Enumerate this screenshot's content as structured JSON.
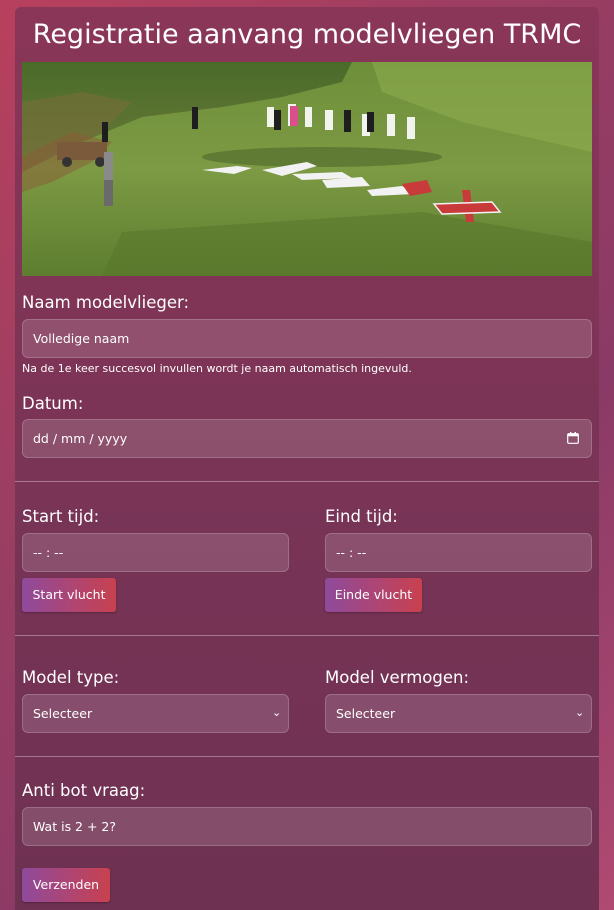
{
  "title": "Registratie aanvang modelvliegen TRMC",
  "naam": {
    "label": "Naam modelvlieger:",
    "placeholder": "Volledige naam",
    "help": "Na de 1e keer succesvol invullen wordt je naam automatisch ingevuld."
  },
  "datum": {
    "label": "Datum:",
    "placeholder": "dd / mm / yyyy",
    "icon": "calendar-icon"
  },
  "start": {
    "label": "Start tijd:",
    "placeholder": "-- : --",
    "button": "Start vlucht"
  },
  "eind": {
    "label": "Eind tijd:",
    "placeholder": "-- : --",
    "button": "Einde vlucht"
  },
  "model_type": {
    "label": "Model type:",
    "selected": "Selecteer"
  },
  "model_vermogen": {
    "label": "Model vermogen:",
    "selected": "Selecteer"
  },
  "antibot": {
    "label": "Anti bot vraag:",
    "placeholder": "Wat is 2 + 2?"
  },
  "submit": "Verzenden",
  "colors": {
    "button_start": "#8f4a9c",
    "button_end": "#c8414f",
    "card": "#7a3456"
  }
}
